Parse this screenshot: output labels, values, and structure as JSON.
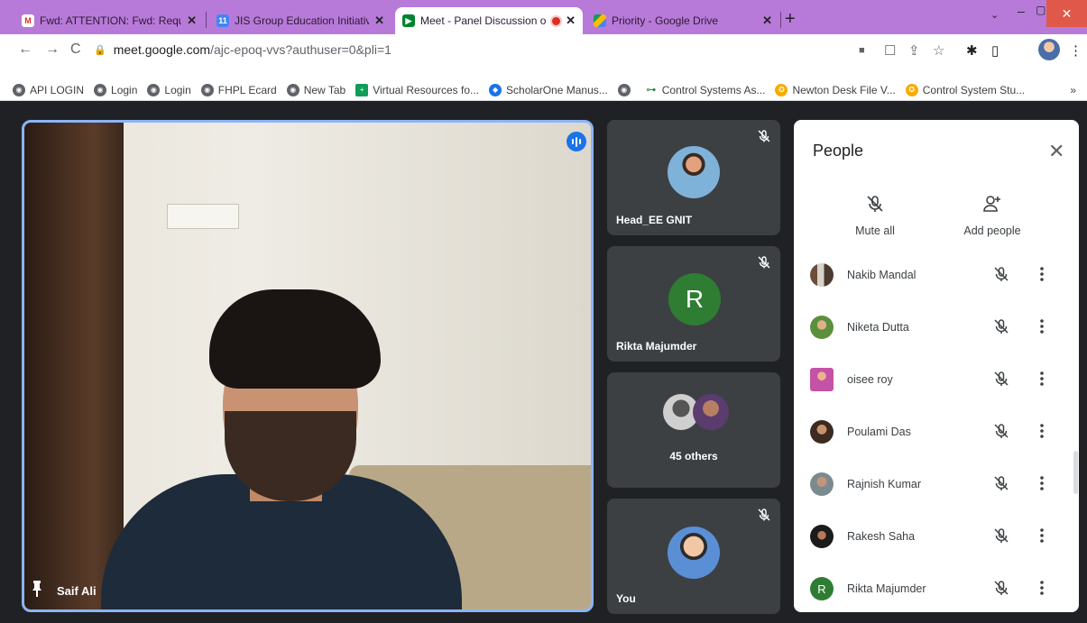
{
  "browser": {
    "tabs": [
      {
        "title": "Fwd: ATTENTION: Fwd: Required",
        "favicon": "gmail-icon"
      },
      {
        "title": "JIS Group Education Initiatives -",
        "favicon": "calendar-icon"
      },
      {
        "title": "Meet - Panel Discussion on",
        "favicon": "meet-icon",
        "active": true,
        "recording": true
      },
      {
        "title": "Priority - Google Drive",
        "favicon": "drive-icon"
      }
    ],
    "new_tab": "+",
    "url_host": "meet.google.com",
    "url_path": "/ajc-epoq-vvs?authuser=0&pli=1",
    "bookmarks": [
      {
        "label": "API LOGIN",
        "icon": "globe-icon"
      },
      {
        "label": "Login",
        "icon": "globe-icon"
      },
      {
        "label": "Login",
        "icon": "globe-icon"
      },
      {
        "label": "FHPL Ecard",
        "icon": "globe-icon"
      },
      {
        "label": "New Tab",
        "icon": "globe-icon"
      },
      {
        "label": "Virtual Resources fo...",
        "icon": "plus-box-icon"
      },
      {
        "label": "ScholarOne Manus...",
        "icon": "scholarone-icon"
      },
      {
        "label": "",
        "icon": "globe-icon"
      },
      {
        "label": "Control Systems As...",
        "icon": "key-icon"
      },
      {
        "label": "Newton Desk File V...",
        "icon": "emblem-icon"
      },
      {
        "label": "Control System Stu...",
        "icon": "emblem-icon"
      }
    ],
    "bookmarks_more": "»",
    "accent_color": "#b87ad9"
  },
  "meet": {
    "main_speaker": {
      "name": "Saif Ali"
    },
    "tiles": [
      {
        "name": "Head_EE GNIT",
        "type": "photo"
      },
      {
        "name": "Rikta Majumder",
        "type": "initial",
        "initial": "R"
      },
      {
        "name": "45 others",
        "type": "group"
      },
      {
        "name": "You",
        "type": "photo"
      }
    ],
    "people_panel": {
      "title": "People",
      "mute_all": "Mute all",
      "add_people": "Add people",
      "participants": [
        {
          "name": "Nakib Mandal",
          "avatar": "photo"
        },
        {
          "name": "Niketa Dutta",
          "avatar": "photo"
        },
        {
          "name": "oisee roy",
          "avatar": "photo"
        },
        {
          "name": "Poulami Das",
          "avatar": "photo"
        },
        {
          "name": "Rajnish Kumar",
          "avatar": "photo"
        },
        {
          "name": "Rakesh Saha",
          "avatar": "photo"
        },
        {
          "name": "Rikta Majumder",
          "avatar": "initial",
          "initial": "R"
        }
      ]
    }
  }
}
